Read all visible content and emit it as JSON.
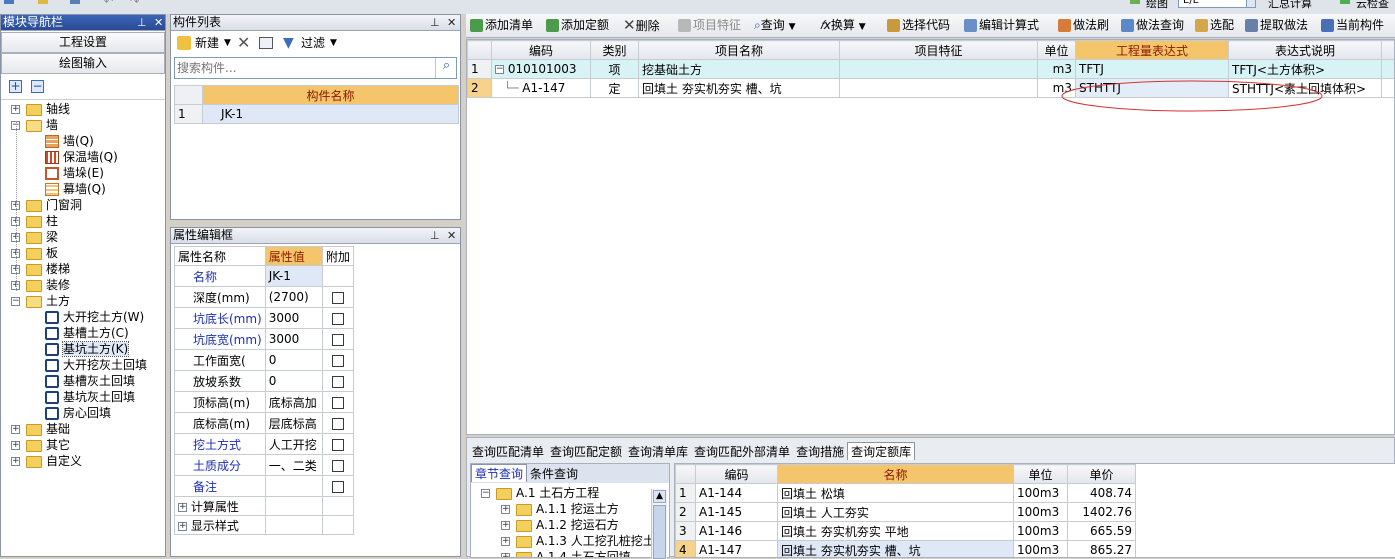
{
  "top_strip": {
    "label1": "绘图",
    "field1": "E/E",
    "label2": "汇总计算",
    "label3": "云检查"
  },
  "nav": {
    "title": "模块导航栏",
    "buttons": [
      "工程设置",
      "绘图输入"
    ],
    "tree": [
      {
        "label": "轴线",
        "level": 0,
        "exp": "+",
        "icon": "folder"
      },
      {
        "label": "墙",
        "level": 0,
        "exp": "-",
        "icon": "folder-open"
      },
      {
        "label": "墙(Q)",
        "level": 1,
        "icon": "wall"
      },
      {
        "label": "保温墙(Q)",
        "level": 1,
        "icon": "ins"
      },
      {
        "label": "墙垛(E)",
        "level": 1,
        "icon": "col"
      },
      {
        "label": "幕墙(Q)",
        "level": 1,
        "icon": "cur"
      },
      {
        "label": "门窗洞",
        "level": 0,
        "exp": "+",
        "icon": "folder"
      },
      {
        "label": "柱",
        "level": 0,
        "exp": "+",
        "icon": "folder"
      },
      {
        "label": "梁",
        "level": 0,
        "exp": "+",
        "icon": "folder"
      },
      {
        "label": "板",
        "level": 0,
        "exp": "+",
        "icon": "folder"
      },
      {
        "label": "楼梯",
        "level": 0,
        "exp": "+",
        "icon": "folder"
      },
      {
        "label": "装修",
        "level": 0,
        "exp": "+",
        "icon": "folder"
      },
      {
        "label": "土方",
        "level": 0,
        "exp": "-",
        "icon": "folder-open"
      },
      {
        "label": "大开挖土方(W)",
        "level": 1,
        "icon": "blue"
      },
      {
        "label": "基槽土方(C)",
        "level": 1,
        "icon": "blue"
      },
      {
        "label": "基坑土方(K)",
        "level": 1,
        "icon": "blue",
        "selected": true
      },
      {
        "label": "大开挖灰土回填",
        "level": 1,
        "icon": "blue"
      },
      {
        "label": "基槽灰土回填",
        "level": 1,
        "icon": "blue"
      },
      {
        "label": "基坑灰土回填",
        "level": 1,
        "icon": "blue"
      },
      {
        "label": "房心回填",
        "level": 1,
        "icon": "blue"
      },
      {
        "label": "基础",
        "level": 0,
        "exp": "+",
        "icon": "folder"
      },
      {
        "label": "其它",
        "level": 0,
        "exp": "+",
        "icon": "folder"
      },
      {
        "label": "自定义",
        "level": 0,
        "exp": "+",
        "icon": "folder"
      }
    ]
  },
  "components": {
    "title": "构件列表",
    "toolbar": {
      "new": "新建",
      "filter": "过滤"
    },
    "search_placeholder": "搜索构件...",
    "col_header": "构件名称",
    "rows": [
      {
        "no": "1",
        "name": "JK-1"
      }
    ]
  },
  "props": {
    "title": "属性编辑框",
    "headers": [
      "属性名称",
      "属性值",
      "附加"
    ],
    "rows": [
      {
        "name": "名称",
        "value": "JK-1",
        "blue": true,
        "check": false
      },
      {
        "name": "深度(mm)",
        "value": "(2700)",
        "blue": false,
        "check": true
      },
      {
        "name": "坑底长(mm)",
        "value": "3000",
        "blue": true,
        "check": true
      },
      {
        "name": "坑底宽(mm)",
        "value": "3000",
        "blue": true,
        "check": true
      },
      {
        "name": "工作面宽(",
        "value": "0",
        "blue": false,
        "check": true
      },
      {
        "name": "放坡系数",
        "value": "0",
        "blue": false,
        "check": true
      },
      {
        "name": "顶标高(m)",
        "value": "底标高加",
        "blue": false,
        "check": true
      },
      {
        "name": "底标高(m)",
        "value": "层底标高",
        "blue": false,
        "check": true
      },
      {
        "name": "挖土方式",
        "value": "人工开挖",
        "blue": true,
        "check": true
      },
      {
        "name": "土质成分",
        "value": "一、二类",
        "blue": true,
        "check": true
      },
      {
        "name": "备注",
        "value": "",
        "blue": true,
        "check": true
      }
    ],
    "groups": [
      "计算属性",
      "显示样式"
    ]
  },
  "right_toolbar": [
    "添加清单",
    "添加定额",
    "删除",
    "项目特征",
    "查询",
    "换算",
    "选择代码",
    "编辑计算式",
    "做法刷",
    "做法查询",
    "选配",
    "提取做法",
    "当前构件"
  ],
  "main_grid": {
    "headers": [
      "编码",
      "类别",
      "项目名称",
      "项目特征",
      "单位",
      "工程量表达式",
      "表达式说明"
    ],
    "rows": [
      {
        "no": "1",
        "code": "010101003",
        "type": "项",
        "name": "挖基础土方",
        "feature": "",
        "unit": "m3",
        "expr": "TFTJ",
        "desc": "TFTJ<土方体积>"
      },
      {
        "no": "2",
        "code": "A1-147",
        "type": "定",
        "name": "回填土 夯实机夯实 槽、坑",
        "feature": "",
        "unit": "m3",
        "expr": "STHTTJ",
        "desc": "STHTTJ<素土回填体积>"
      }
    ]
  },
  "bottom": {
    "tabs": [
      "查询匹配清单",
      "查询匹配定额",
      "查询清单库",
      "查询匹配外部清单",
      "查询措施",
      "查询定额库"
    ],
    "subtabs": [
      "章节查询",
      "条件查询"
    ],
    "tree": [
      {
        "label": "A.1 土石方工程",
        "exp": "-",
        "level": 0
      },
      {
        "label": "A.1.1 挖运土方",
        "exp": "+",
        "level": 1
      },
      {
        "label": "A.1.2 挖运石方",
        "exp": "+",
        "level": 1
      },
      {
        "label": "A.1.3 人工挖孔桩挖土",
        "exp": "+",
        "level": 1
      },
      {
        "label": "A.1.4 土石方回填",
        "exp": "+",
        "level": 1
      }
    ],
    "grid_headers": [
      "编码",
      "名称",
      "单位",
      "单价"
    ],
    "grid_rows": [
      {
        "no": "1",
        "code": "A1-144",
        "name": "回填土 松填",
        "unit": "100m3",
        "price": "408.74"
      },
      {
        "no": "2",
        "code": "A1-145",
        "name": "回填土 人工夯实",
        "unit": "100m3",
        "price": "1402.76"
      },
      {
        "no": "3",
        "code": "A1-146",
        "name": "回填土 夯实机夯实 平地",
        "unit": "100m3",
        "price": "665.59"
      },
      {
        "no": "4",
        "code": "A1-147",
        "name": "回填土 夯实机夯实 槽、坑",
        "unit": "100m3",
        "price": "865.27"
      }
    ]
  }
}
